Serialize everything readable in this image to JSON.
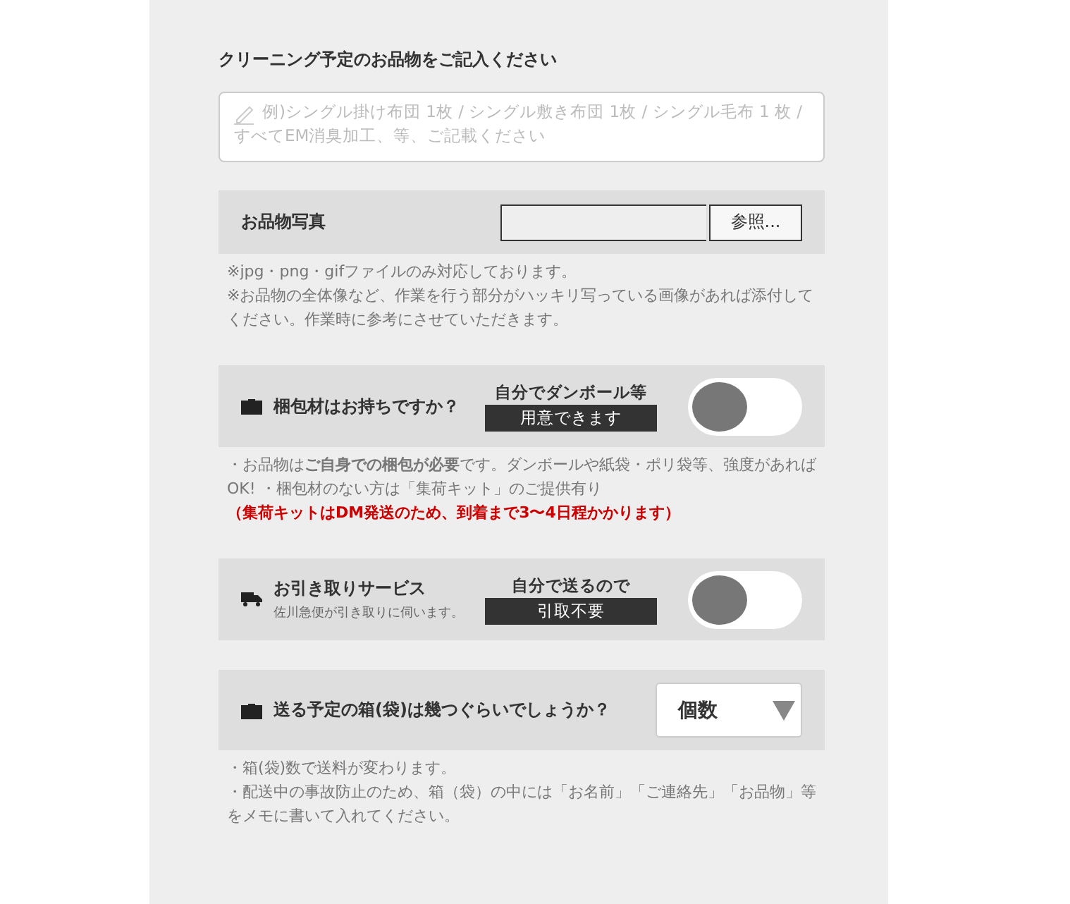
{
  "items_section": {
    "label": "クリーニング予定のお品物をご記入ください",
    "placeholder": "例)シングル掛け布団 1枚 / シングル敷き布団 1枚 / シングル毛布 1 枚 / すべてEM消臭加工、等、ご記載ください"
  },
  "photo_section": {
    "label": "お品物写真",
    "browse_button": "参照...",
    "notes": [
      "※jpg・png・gifファイルのみ対応しております。",
      "※お品物の全体像など、作業を行う部分がハッキリ写っている画像があれば添付してください。作業時に参考にさせていただきます。"
    ]
  },
  "options": [
    {
      "kind": "toggle",
      "label": "梱包材はお持ちですか？",
      "toggle_caption": "自分でダンボール等",
      "toggle_badge": "用意できます",
      "on": false,
      "notes": [
        {
          "kind": "plain",
          "text": "・お品物は**ご自身での梱包が必要**です。ダンボールや紙袋・ポリ袋等、強度があればOK! ・梱包材のない方は「集荷キット」のご提供有り"
        },
        {
          "kind": "warning",
          "text": "（集荷キットはDM発送のため、到着まで3〜4日程かかります）"
        }
      ]
    },
    {
      "kind": "toggle",
      "label": "お引き取りサービス",
      "sublabel": "佐川急便が引き取りに伺います。",
      "toggle_caption": "自分で送るので",
      "toggle_badge": "引取不要",
      "on": false
    },
    {
      "kind": "select",
      "label": "送る予定の箱(袋)は幾つぐらいでしょうか？",
      "select_value": "個数",
      "notes": [
        {
          "kind": "plain",
          "text": "・箱(袋)数で送料が変わります。"
        },
        {
          "kind": "plain",
          "text": "・配送中の事故防止のため、箱（袋）の中には「お名前」「ご連絡先」「お品物」等をメモに書いて入れてください。"
        }
      ]
    }
  ]
}
